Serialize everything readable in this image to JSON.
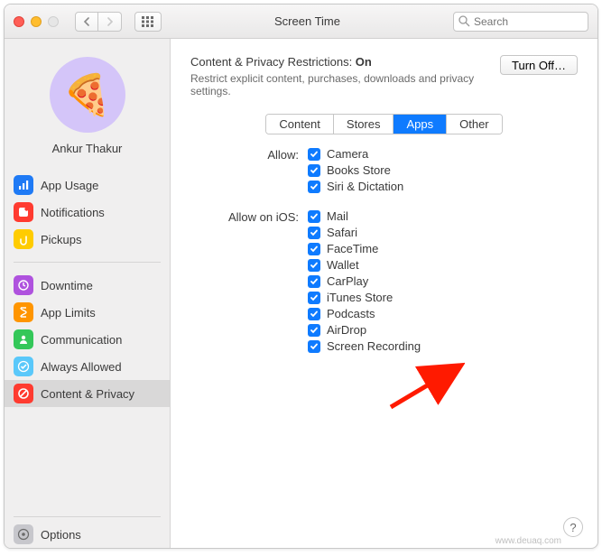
{
  "window": {
    "title": "Screen Time"
  },
  "search": {
    "placeholder": "Search"
  },
  "profile": {
    "name": "Ankur Thakur",
    "avatar_emoji": "🍕"
  },
  "sidebar": {
    "group1": [
      {
        "label": "App Usage",
        "icon": "bars-icon",
        "color": "bg-blue"
      },
      {
        "label": "Notifications",
        "icon": "bell-icon",
        "color": "bg-red"
      },
      {
        "label": "Pickups",
        "icon": "hand-icon",
        "color": "bg-yellow"
      }
    ],
    "group2": [
      {
        "label": "Downtime",
        "icon": "clock-icon",
        "color": "bg-purple"
      },
      {
        "label": "App Limits",
        "icon": "hourglass-icon",
        "color": "bg-orange"
      },
      {
        "label": "Communication",
        "icon": "person-icon",
        "color": "bg-green"
      },
      {
        "label": "Always Allowed",
        "icon": "check-icon",
        "color": "bg-teal"
      },
      {
        "label": "Content & Privacy",
        "icon": "nosign-icon",
        "color": "bg-red",
        "selected": true
      }
    ],
    "bottom": {
      "label": "Options",
      "icon": "gear-icon",
      "color": "bg-gray"
    }
  },
  "header": {
    "title_prefix": "Content & Privacy Restrictions: ",
    "status": "On",
    "subtitle": "Restrict explicit content, purchases, downloads and privacy settings.",
    "turn_off": "Turn Off…"
  },
  "tabs": [
    "Content",
    "Stores",
    "Apps",
    "Other"
  ],
  "active_tab": "Apps",
  "sections": [
    {
      "label": "Allow:",
      "items": [
        "Camera",
        "Books Store",
        "Siri & Dictation"
      ]
    },
    {
      "label": "Allow on iOS:",
      "items": [
        "Mail",
        "Safari",
        "FaceTime",
        "Wallet",
        "CarPlay",
        "iTunes Store",
        "Podcasts",
        "AirDrop",
        "Screen Recording"
      ]
    }
  ],
  "watermark": "www.deuaq.com"
}
